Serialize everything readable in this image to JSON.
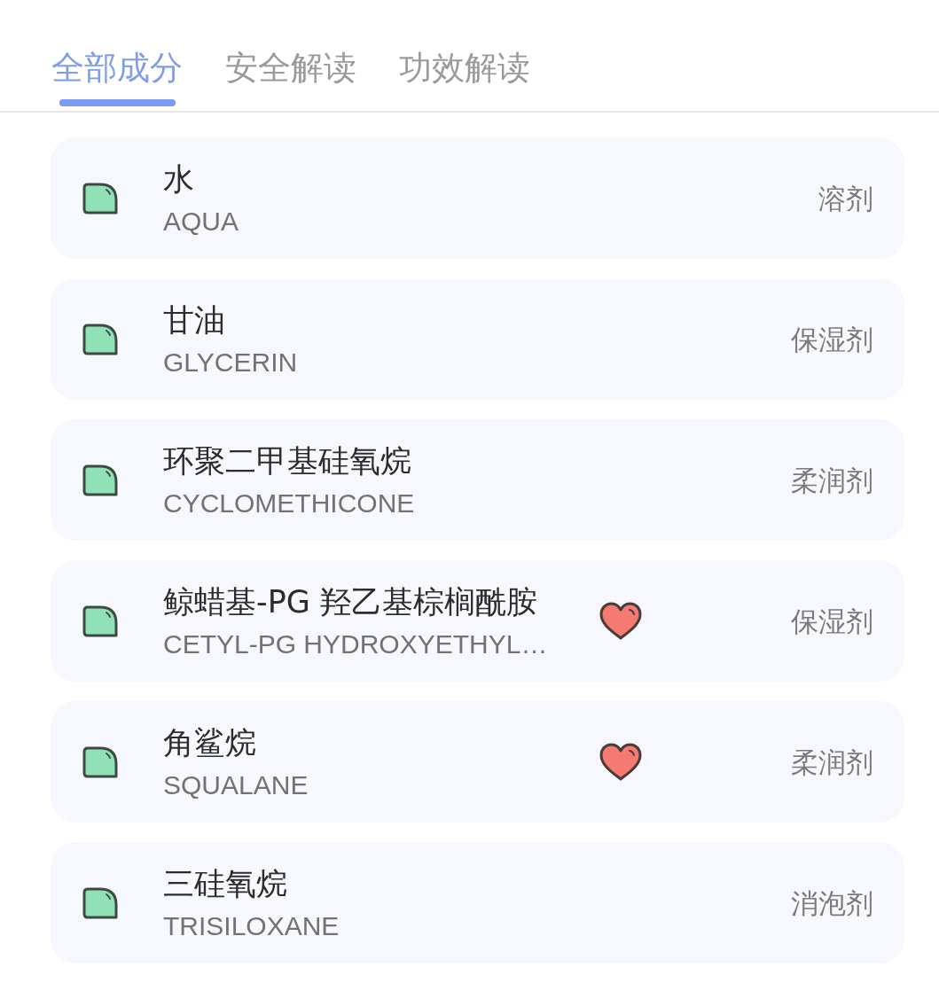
{
  "tabs": [
    {
      "label": "全部成分",
      "selected": true
    },
    {
      "label": "安全解读",
      "selected": false
    },
    {
      "label": "功效解读",
      "selected": false
    }
  ],
  "ingredients": [
    {
      "name": "水",
      "inci": "AQUA",
      "liked": false,
      "function": "溶剂"
    },
    {
      "name": "甘油",
      "inci": "GLYCERIN",
      "liked": false,
      "function": "保湿剂"
    },
    {
      "name": "环聚二甲基硅氧烷",
      "inci": "CYCLOMETHICONE",
      "liked": false,
      "function": "柔润剂"
    },
    {
      "name": "鲸蜡基-PG 羟乙基棕榈酰胺",
      "inci": "CETYL-PG HYDROXYETHYL…",
      "liked": true,
      "function": "保湿剂"
    },
    {
      "name": "角鲨烷",
      "inci": "SQUALANE",
      "liked": true,
      "function": "柔润剂"
    },
    {
      "name": "三硅氧烷",
      "inci": "TRISILOXANE",
      "liked": false,
      "function": "消泡剂"
    }
  ]
}
